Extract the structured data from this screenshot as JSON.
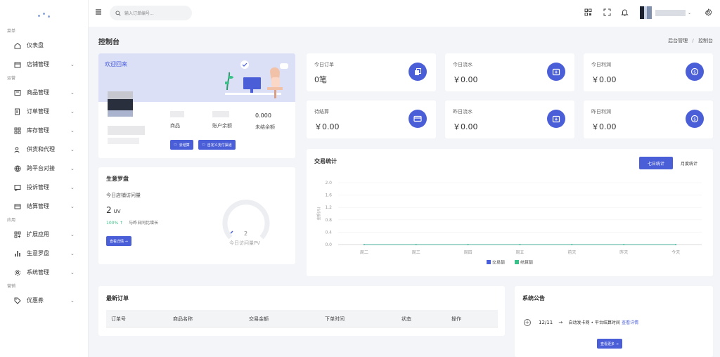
{
  "sidebar": {
    "sections": [
      "菜单",
      "运营",
      "应用",
      "营销"
    ],
    "items": [
      {
        "label": "仪表盘",
        "icon": "home-icon",
        "chevron": false
      },
      {
        "label": "店铺管理",
        "icon": "store-icon",
        "chevron": true
      },
      {
        "label": "商品管理",
        "icon": "box-icon",
        "chevron": true
      },
      {
        "label": "订单管理",
        "icon": "order-icon",
        "chevron": true
      },
      {
        "label": "库存管理",
        "icon": "grid-icon",
        "chevron": true
      },
      {
        "label": "供货和代理",
        "icon": "users-icon",
        "chevron": true
      },
      {
        "label": "跨平台对接",
        "icon": "globe-icon",
        "chevron": true
      },
      {
        "label": "投诉管理",
        "icon": "complaint-icon",
        "chevron": true
      },
      {
        "label": "结算管理",
        "icon": "card-icon",
        "chevron": true
      },
      {
        "label": "扩展应用",
        "icon": "apps-icon",
        "chevron": true
      },
      {
        "label": "生意罗盘",
        "icon": "bar-chart-icon",
        "chevron": true
      },
      {
        "label": "系统管理",
        "icon": "gear-icon",
        "chevron": true
      },
      {
        "label": "优惠券",
        "icon": "tag-icon",
        "chevron": true
      }
    ]
  },
  "topbar": {
    "search_placeholder": "输入订单编号..."
  },
  "page": {
    "title": "控制台",
    "breadcrumb": [
      "后台管理",
      "/",
      "控制台"
    ]
  },
  "welcome": {
    "title": "欢迎回来",
    "stats": [
      {
        "value": "",
        "label": "商品"
      },
      {
        "value": "",
        "label": "账户余额"
      },
      {
        "value": "0.000",
        "label": "未结余额"
      }
    ],
    "btn_settle": "去结算",
    "btn_channel": "自定义支付渠道"
  },
  "kpis": [
    {
      "label": "今日订单",
      "value": "0笔",
      "icon": "copy-icon"
    },
    {
      "label": "今日流水",
      "value": "￥0.00",
      "icon": "wallet-icon"
    },
    {
      "label": "今日利润",
      "value": "￥0.00",
      "icon": "coin-icon"
    },
    {
      "label": "待结算",
      "value": "￥0.00",
      "icon": "credit-card-icon"
    },
    {
      "label": "昨日流水",
      "value": "￥0.00",
      "icon": "wallet-icon"
    },
    {
      "label": "昨日利润",
      "value": "￥0.00",
      "icon": "coin-icon"
    }
  ],
  "compass": {
    "title": "生意罗盘",
    "visits_label": "今日店铺访问量",
    "uv_value": "2",
    "uv_unit": "UV",
    "growth": "100% ↑",
    "growth_text": "与昨日同比增长",
    "btn": "查看详情 →",
    "pv_value": "2",
    "pv_label": "今日访问量PV"
  },
  "chart": {
    "title": "交易统计",
    "tab_week": "七日统计",
    "tab_month": "月度统计"
  },
  "chart_data": {
    "type": "line",
    "categories": [
      "周二",
      "周三",
      "周四",
      "周五",
      "前天",
      "昨天",
      "今天"
    ],
    "ylabel": "金额(元)",
    "ylim": [
      0,
      2
    ],
    "yticks": [
      "2.0",
      "1.6",
      "1.2",
      "0.8",
      "0.4",
      "0.0"
    ],
    "series": [
      {
        "name": "交易额",
        "color": "#4a5ed8",
        "values": [
          0,
          0,
          0,
          0,
          0,
          0,
          0
        ]
      },
      {
        "name": "结算额",
        "color": "#3cc08a",
        "values": [
          0,
          0,
          0,
          0,
          0,
          0,
          0
        ]
      }
    ],
    "grid": true,
    "legend": "bottom"
  },
  "orders": {
    "title": "最新订单",
    "columns": [
      "订单号",
      "商品名称",
      "交易金额",
      "下单时间",
      "状态",
      "操作"
    ]
  },
  "notice": {
    "title": "系统公告",
    "date": "12/11",
    "arrow": "→",
    "text": "自动发卡网 • 平台结算时间",
    "link": "查看详情",
    "btn": "查看更多 →"
  }
}
